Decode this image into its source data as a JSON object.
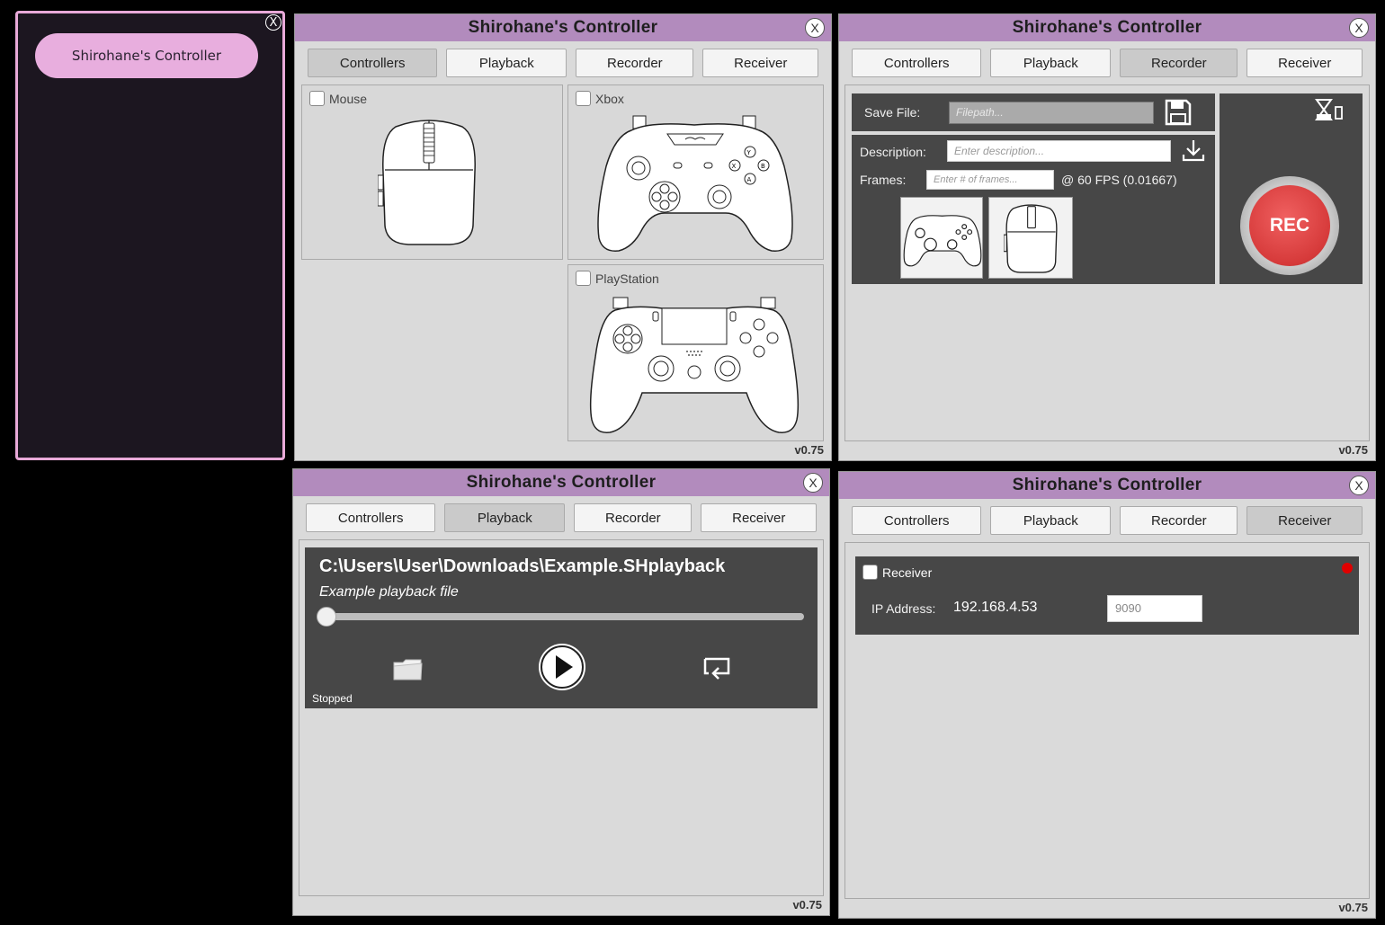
{
  "launcher": {
    "button_label": "Shirohane's Controller",
    "close_label": "X"
  },
  "app": {
    "title": "Shirohane's Controller",
    "close_label": "X",
    "version": "v0.75",
    "tabs": [
      "Controllers",
      "Playback",
      "Recorder",
      "Receiver"
    ]
  },
  "controllers": {
    "mouse_label": "Mouse",
    "xbox_label": "Xbox",
    "playstation_label": "PlayStation"
  },
  "recorder": {
    "save_file_label": "Save File:",
    "save_file_placeholder": "Filepath...",
    "description_label": "Description:",
    "description_placeholder": "Enter description...",
    "frames_label": "Frames:",
    "frames_placeholder": "Enter # of frames...",
    "fps_text": "@ 60 FPS (0.01667)",
    "rec_label": "REC"
  },
  "playback": {
    "filepath": "C:\\Users\\User\\Downloads\\Example.SHplayback",
    "description": "Example playback file",
    "status": "Stopped",
    "progress": 0
  },
  "receiver": {
    "checkbox_label": "Receiver",
    "ip_label": "IP Address:",
    "ip_value": "192.168.4.53",
    "port_value": "9090",
    "status_color": "#e00000"
  },
  "colors": {
    "titlebar": "#b28bbd",
    "launcher_accent": "#e8aede",
    "rec_red": "#e24a4a"
  }
}
